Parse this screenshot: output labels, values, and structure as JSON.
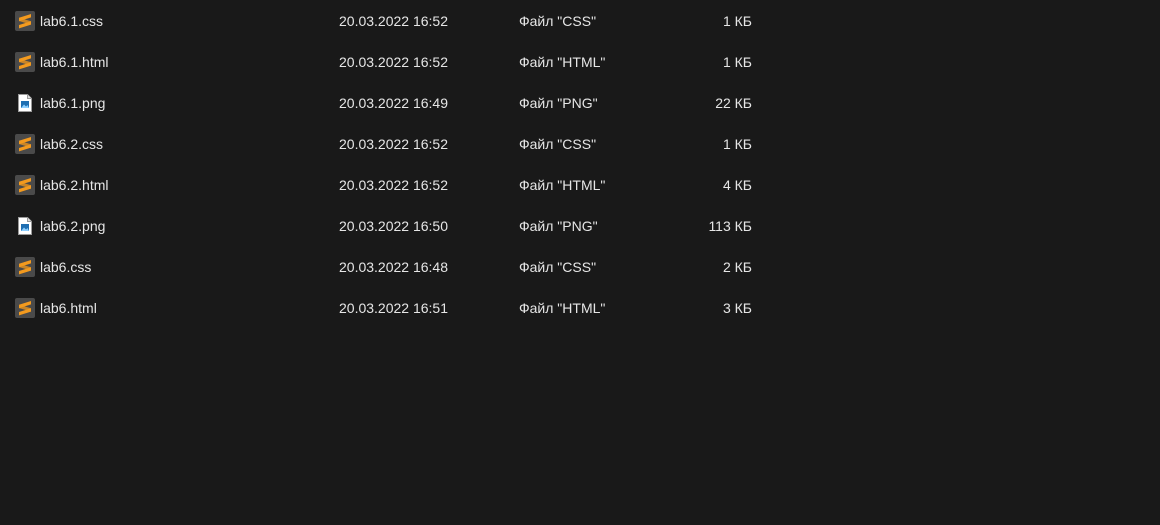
{
  "files": [
    {
      "name": "lab6.1.css",
      "date": "20.03.2022 16:52",
      "type": "Файл \"CSS\"",
      "size": "1 КБ",
      "icon": "sublime-text-icon"
    },
    {
      "name": "lab6.1.html",
      "date": "20.03.2022 16:52",
      "type": "Файл \"HTML\"",
      "size": "1 КБ",
      "icon": "sublime-text-icon"
    },
    {
      "name": "lab6.1.png",
      "date": "20.03.2022 16:49",
      "type": "Файл \"PNG\"",
      "size": "22 КБ",
      "icon": "image-file-icon"
    },
    {
      "name": "lab6.2.css",
      "date": "20.03.2022 16:52",
      "type": "Файл \"CSS\"",
      "size": "1 КБ",
      "icon": "sublime-text-icon"
    },
    {
      "name": "lab6.2.html",
      "date": "20.03.2022 16:52",
      "type": "Файл \"HTML\"",
      "size": "4 КБ",
      "icon": "sublime-text-icon"
    },
    {
      "name": "lab6.2.png",
      "date": "20.03.2022 16:50",
      "type": "Файл \"PNG\"",
      "size": "113 КБ",
      "icon": "image-file-icon"
    },
    {
      "name": "lab6.css",
      "date": "20.03.2022 16:48",
      "type": "Файл \"CSS\"",
      "size": "2 КБ",
      "icon": "sublime-text-icon"
    },
    {
      "name": "lab6.html",
      "date": "20.03.2022 16:51",
      "type": "Файл \"HTML\"",
      "size": "3 КБ",
      "icon": "sublime-text-icon"
    }
  ],
  "colors": {
    "background": "#191919",
    "text": "#e6e6e6",
    "sublime_tile": "#4a4a4a",
    "sublime_accent": "#f39a1e",
    "image_doc": "#ffffff",
    "image_accent": "#1f6fb2"
  }
}
